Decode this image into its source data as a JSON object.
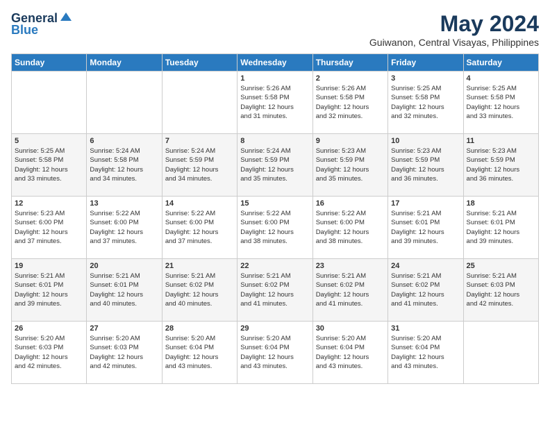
{
  "header": {
    "logo_general": "General",
    "logo_blue": "Blue",
    "month_title": "May 2024",
    "location": "Guiwanon, Central Visayas, Philippines"
  },
  "weekdays": [
    "Sunday",
    "Monday",
    "Tuesday",
    "Wednesday",
    "Thursday",
    "Friday",
    "Saturday"
  ],
  "weeks": [
    [
      {
        "day": "",
        "info": ""
      },
      {
        "day": "",
        "info": ""
      },
      {
        "day": "",
        "info": ""
      },
      {
        "day": "1",
        "info": "Sunrise: 5:26 AM\nSunset: 5:58 PM\nDaylight: 12 hours\nand 31 minutes."
      },
      {
        "day": "2",
        "info": "Sunrise: 5:26 AM\nSunset: 5:58 PM\nDaylight: 12 hours\nand 32 minutes."
      },
      {
        "day": "3",
        "info": "Sunrise: 5:25 AM\nSunset: 5:58 PM\nDaylight: 12 hours\nand 32 minutes."
      },
      {
        "day": "4",
        "info": "Sunrise: 5:25 AM\nSunset: 5:58 PM\nDaylight: 12 hours\nand 33 minutes."
      }
    ],
    [
      {
        "day": "5",
        "info": "Sunrise: 5:25 AM\nSunset: 5:58 PM\nDaylight: 12 hours\nand 33 minutes."
      },
      {
        "day": "6",
        "info": "Sunrise: 5:24 AM\nSunset: 5:58 PM\nDaylight: 12 hours\nand 34 minutes."
      },
      {
        "day": "7",
        "info": "Sunrise: 5:24 AM\nSunset: 5:59 PM\nDaylight: 12 hours\nand 34 minutes."
      },
      {
        "day": "8",
        "info": "Sunrise: 5:24 AM\nSunset: 5:59 PM\nDaylight: 12 hours\nand 35 minutes."
      },
      {
        "day": "9",
        "info": "Sunrise: 5:23 AM\nSunset: 5:59 PM\nDaylight: 12 hours\nand 35 minutes."
      },
      {
        "day": "10",
        "info": "Sunrise: 5:23 AM\nSunset: 5:59 PM\nDaylight: 12 hours\nand 36 minutes."
      },
      {
        "day": "11",
        "info": "Sunrise: 5:23 AM\nSunset: 5:59 PM\nDaylight: 12 hours\nand 36 minutes."
      }
    ],
    [
      {
        "day": "12",
        "info": "Sunrise: 5:23 AM\nSunset: 6:00 PM\nDaylight: 12 hours\nand 37 minutes."
      },
      {
        "day": "13",
        "info": "Sunrise: 5:22 AM\nSunset: 6:00 PM\nDaylight: 12 hours\nand 37 minutes."
      },
      {
        "day": "14",
        "info": "Sunrise: 5:22 AM\nSunset: 6:00 PM\nDaylight: 12 hours\nand 37 minutes."
      },
      {
        "day": "15",
        "info": "Sunrise: 5:22 AM\nSunset: 6:00 PM\nDaylight: 12 hours\nand 38 minutes."
      },
      {
        "day": "16",
        "info": "Sunrise: 5:22 AM\nSunset: 6:00 PM\nDaylight: 12 hours\nand 38 minutes."
      },
      {
        "day": "17",
        "info": "Sunrise: 5:21 AM\nSunset: 6:01 PM\nDaylight: 12 hours\nand 39 minutes."
      },
      {
        "day": "18",
        "info": "Sunrise: 5:21 AM\nSunset: 6:01 PM\nDaylight: 12 hours\nand 39 minutes."
      }
    ],
    [
      {
        "day": "19",
        "info": "Sunrise: 5:21 AM\nSunset: 6:01 PM\nDaylight: 12 hours\nand 39 minutes."
      },
      {
        "day": "20",
        "info": "Sunrise: 5:21 AM\nSunset: 6:01 PM\nDaylight: 12 hours\nand 40 minutes."
      },
      {
        "day": "21",
        "info": "Sunrise: 5:21 AM\nSunset: 6:02 PM\nDaylight: 12 hours\nand 40 minutes."
      },
      {
        "day": "22",
        "info": "Sunrise: 5:21 AM\nSunset: 6:02 PM\nDaylight: 12 hours\nand 41 minutes."
      },
      {
        "day": "23",
        "info": "Sunrise: 5:21 AM\nSunset: 6:02 PM\nDaylight: 12 hours\nand 41 minutes."
      },
      {
        "day": "24",
        "info": "Sunrise: 5:21 AM\nSunset: 6:02 PM\nDaylight: 12 hours\nand 41 minutes."
      },
      {
        "day": "25",
        "info": "Sunrise: 5:21 AM\nSunset: 6:03 PM\nDaylight: 12 hours\nand 42 minutes."
      }
    ],
    [
      {
        "day": "26",
        "info": "Sunrise: 5:20 AM\nSunset: 6:03 PM\nDaylight: 12 hours\nand 42 minutes."
      },
      {
        "day": "27",
        "info": "Sunrise: 5:20 AM\nSunset: 6:03 PM\nDaylight: 12 hours\nand 42 minutes."
      },
      {
        "day": "28",
        "info": "Sunrise: 5:20 AM\nSunset: 6:04 PM\nDaylight: 12 hours\nand 43 minutes."
      },
      {
        "day": "29",
        "info": "Sunrise: 5:20 AM\nSunset: 6:04 PM\nDaylight: 12 hours\nand 43 minutes."
      },
      {
        "day": "30",
        "info": "Sunrise: 5:20 AM\nSunset: 6:04 PM\nDaylight: 12 hours\nand 43 minutes."
      },
      {
        "day": "31",
        "info": "Sunrise: 5:20 AM\nSunset: 6:04 PM\nDaylight: 12 hours\nand 43 minutes."
      },
      {
        "day": "",
        "info": ""
      }
    ]
  ]
}
